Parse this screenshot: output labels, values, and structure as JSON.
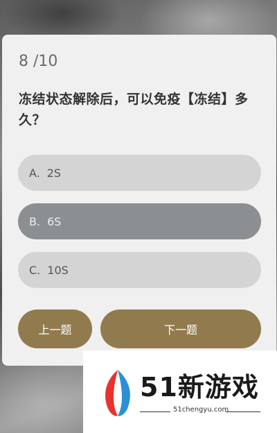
{
  "progress": "8 /10",
  "question": "冻结状态解除后，可以免疫【冻结】多久？",
  "options": [
    {
      "letter": "A.",
      "text": "2S",
      "selected": false
    },
    {
      "letter": "B.",
      "text": "6S",
      "selected": true
    },
    {
      "letter": "C.",
      "text": "10S",
      "selected": false
    }
  ],
  "nav": {
    "prev_label": "上一题",
    "next_label": "下一题"
  },
  "watermark": {
    "brand": "51新游戏",
    "url": "51chengyu.com"
  },
  "colors": {
    "card_bg": "#f0f0f0",
    "option_bg": "#d4d4d4",
    "selected_bg": "#8c8f92",
    "button_bg": "#917b4e"
  }
}
